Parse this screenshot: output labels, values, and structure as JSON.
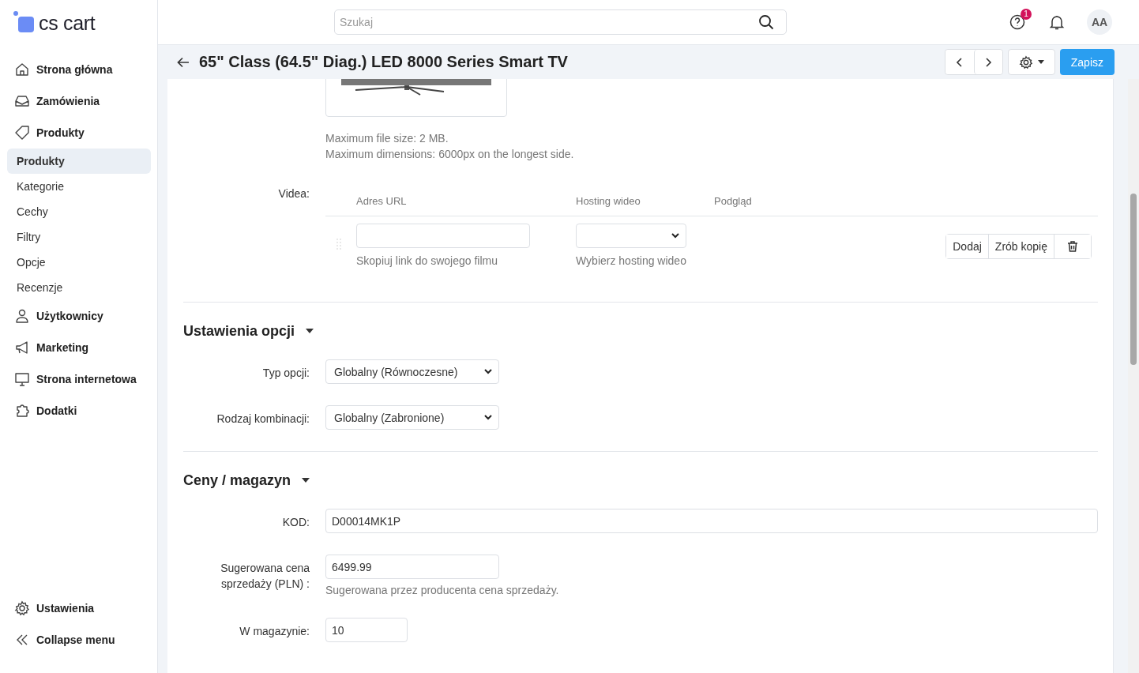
{
  "brand": "cs cart",
  "search": {
    "placeholder": "Szukaj"
  },
  "header": {
    "help_badge": "1",
    "avatar": "AA"
  },
  "sidebar": {
    "items": [
      {
        "label": "Strona główna",
        "kind": "main",
        "selected": false
      },
      {
        "label": "Zamówienia",
        "kind": "main",
        "selected": false
      },
      {
        "label": "Produkty",
        "kind": "main",
        "selected": false
      },
      {
        "label": "Produkty",
        "kind": "sub",
        "selected": true
      },
      {
        "label": "Kategorie",
        "kind": "sub",
        "selected": false
      },
      {
        "label": "Cechy",
        "kind": "sub",
        "selected": false
      },
      {
        "label": "Filtry",
        "kind": "sub",
        "selected": false
      },
      {
        "label": "Opcje",
        "kind": "sub",
        "selected": false
      },
      {
        "label": "Recenzje",
        "kind": "sub",
        "selected": false
      },
      {
        "label": "Użytkownicy",
        "kind": "main",
        "selected": false
      },
      {
        "label": "Marketing",
        "kind": "main",
        "selected": false
      },
      {
        "label": "Strona internetowa",
        "kind": "main",
        "selected": false
      },
      {
        "label": "Dodatki",
        "kind": "main",
        "selected": false
      }
    ],
    "footer": [
      {
        "label": "Ustawienia"
      },
      {
        "label": "Collapse menu"
      }
    ]
  },
  "page": {
    "title": "65\" Class (64.5\" Diag.) LED 8000 Series Smart TV",
    "save_button": "Zapisz"
  },
  "image_notes": [
    "Maximum file size: 2 MB.",
    "Maximum dimensions: 6000px on the longest side."
  ],
  "videos": {
    "label": "Videa:",
    "columns": [
      "Adres URL",
      "Hosting wideo",
      "Podgląd"
    ],
    "url_hint": "Skopiuj link do swojego filmu",
    "hosting_hint": "Wybierz hosting wideo",
    "buttons": [
      "Dodaj",
      "Zrób kopię"
    ]
  },
  "sections": [
    {
      "title": "Ustawienia opcji",
      "expanded": true,
      "fields": [
        {
          "label": "Typ opcji:",
          "kind": "select",
          "value": "Globalny (Równoczesne)"
        },
        {
          "label": "Rodzaj kombinacji:",
          "kind": "select",
          "value": "Globalny (Zabronione)"
        }
      ]
    },
    {
      "title": "Ceny / magazyn",
      "expanded": true,
      "fields": [
        {
          "label": "KOD:",
          "kind": "wide",
          "value": "D00014MK1P"
        },
        {
          "label": "Sugerowana cena sprzedaży (PLN) :",
          "kind": "text",
          "value": "6499.99",
          "hint": "Sugerowana przez producenta cena sprzedaży."
        },
        {
          "label": "W magazynie:",
          "kind": "short",
          "value": "10"
        }
      ]
    }
  ]
}
